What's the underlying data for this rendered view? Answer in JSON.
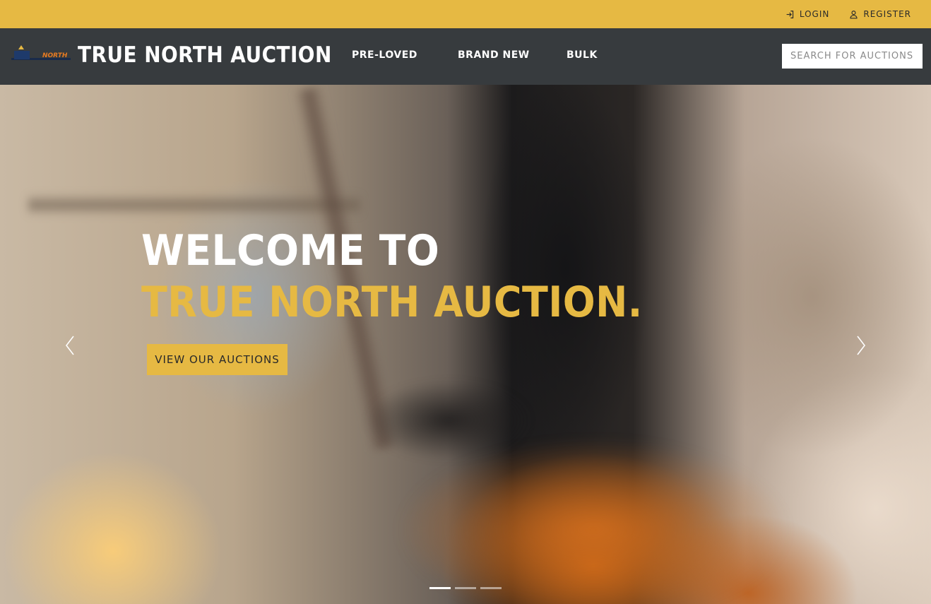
{
  "topbar": {
    "login_label": "LOGIN",
    "register_label": "REGISTER",
    "login_icon": "sign-in-icon",
    "register_icon": "user-icon"
  },
  "navbar": {
    "brand_name": "TRUE NORTH AUCTION",
    "logo_text": "NORTH",
    "items": [
      {
        "label": "PRE-LOVED"
      },
      {
        "label": "BRAND NEW"
      },
      {
        "label": "BULK"
      }
    ],
    "search_placeholder": "SEARCH FOR AUCTIONS"
  },
  "hero": {
    "title_line1": "WELCOME TO",
    "title_line2": "TRUE NORTH AUCTION.",
    "cta_label": "VIEW OUR AUCTIONS",
    "prev_icon": "chevron-left-icon",
    "next_icon": "chevron-right-icon",
    "slides_count": 3,
    "active_slide": 1
  },
  "colors": {
    "accent": "#e6b943",
    "nav_bg": "#373b3e",
    "text_light": "#ffffff",
    "text_dark": "#2a2a2a"
  }
}
